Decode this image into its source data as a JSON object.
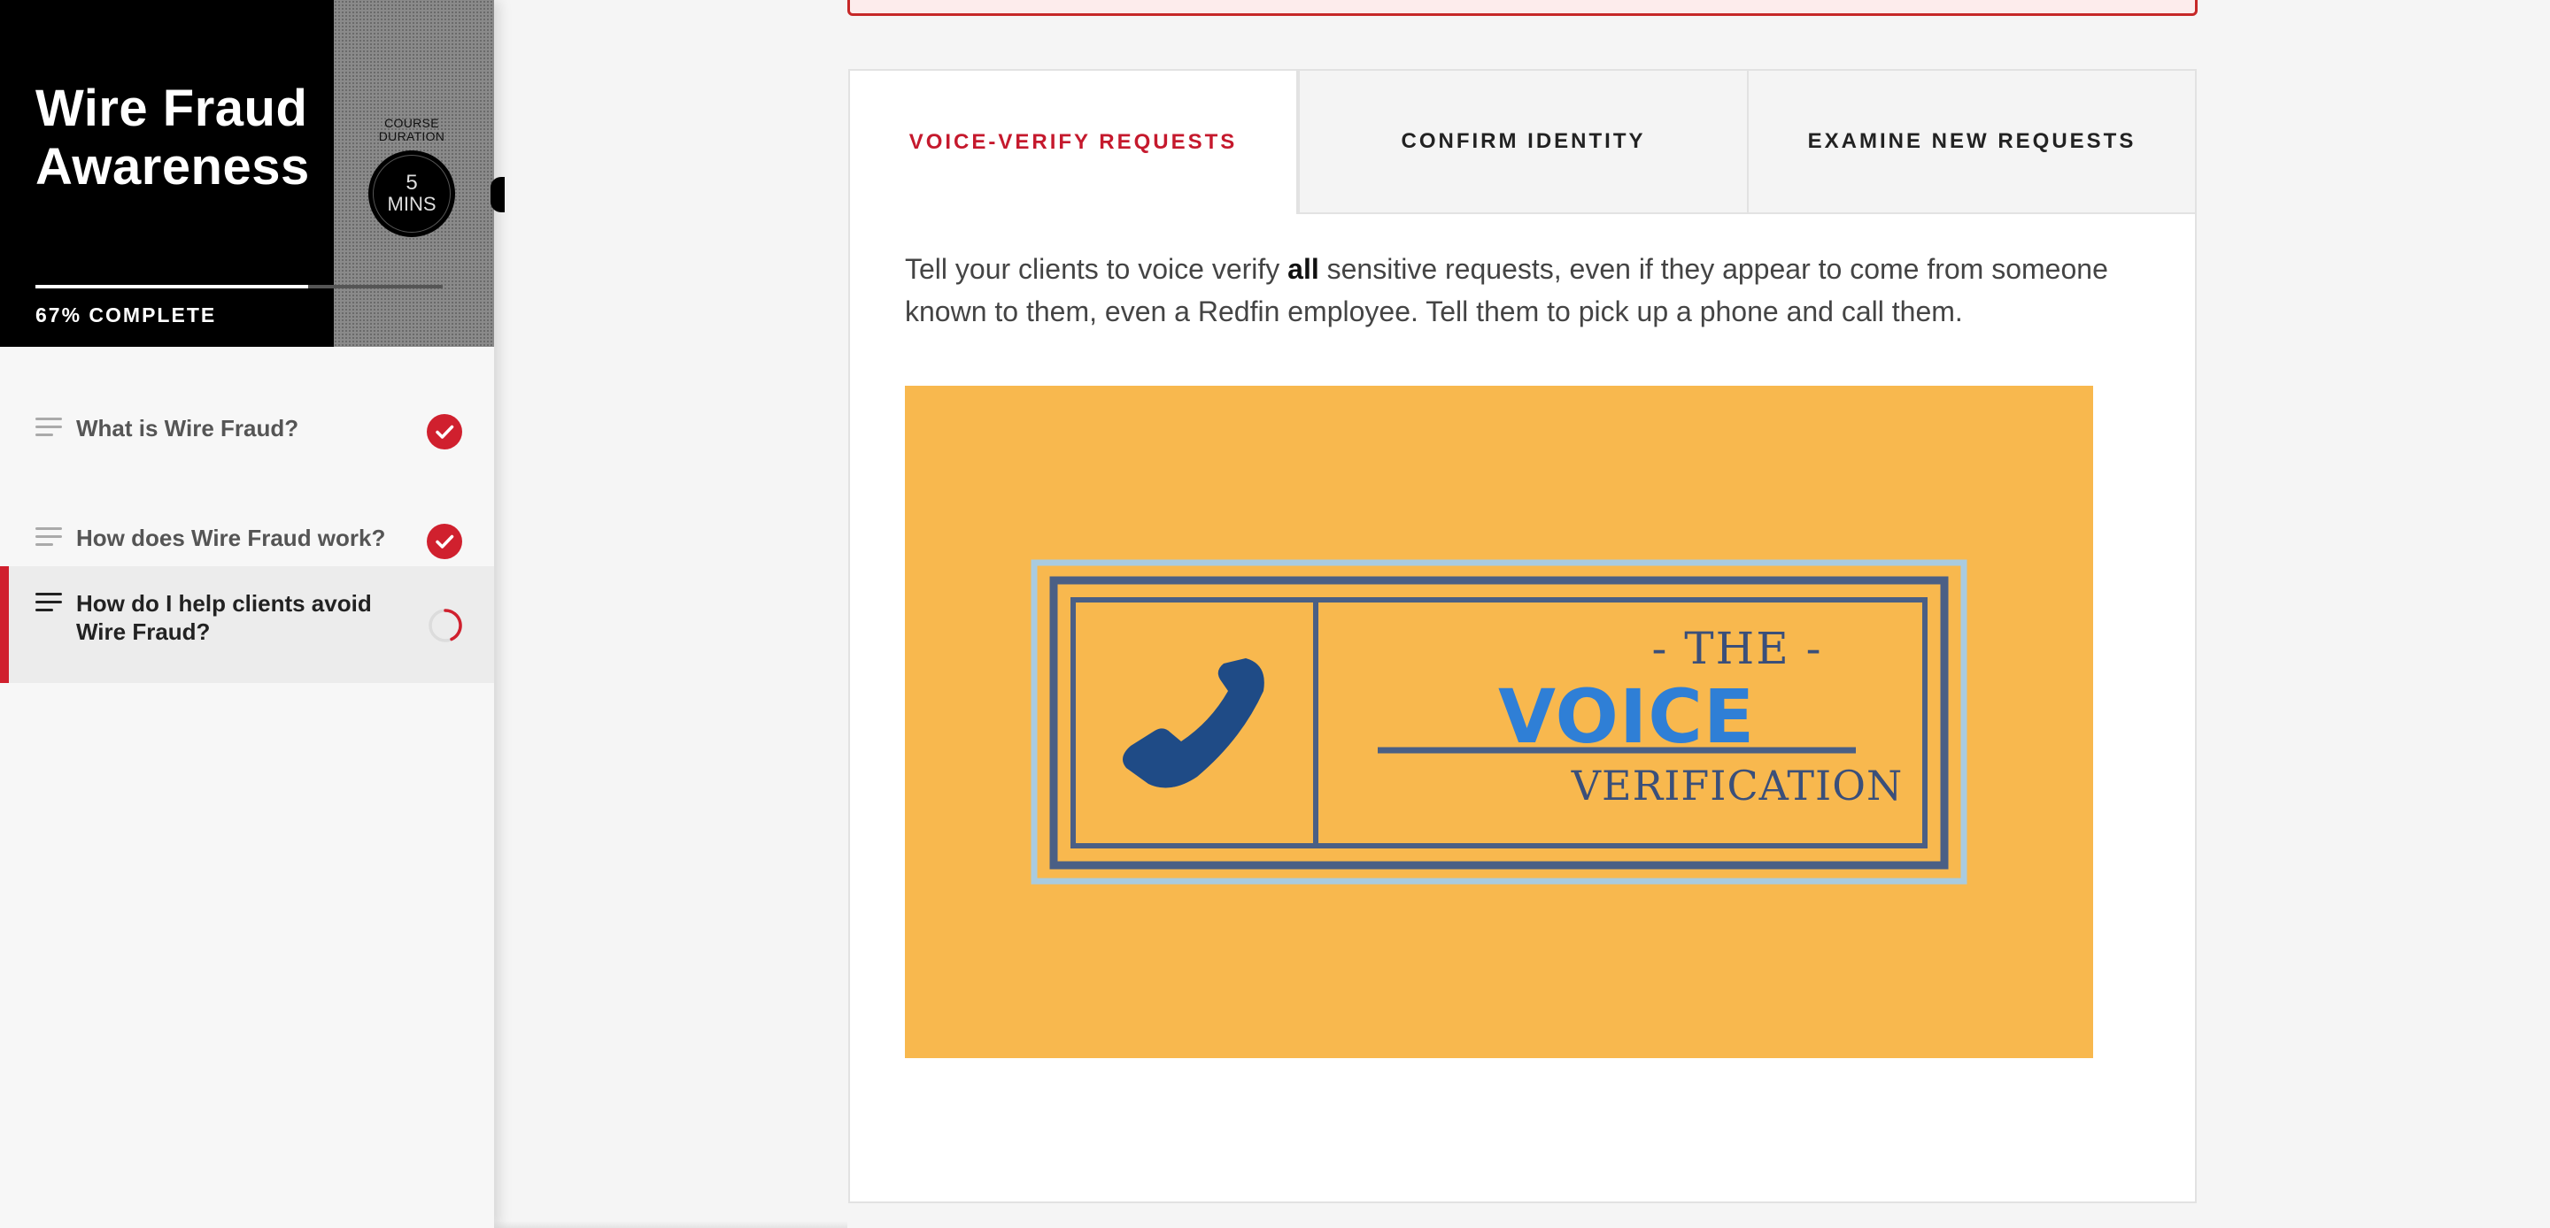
{
  "course": {
    "title": "Wire Fraud Awareness",
    "duration_label": "COURSE DURATION",
    "duration_value": "5",
    "duration_unit": "MINS",
    "progress_percent": 67,
    "progress_text": "67% COMPLETE"
  },
  "lessons": [
    {
      "label": "What is Wire Fraud?",
      "status": "complete",
      "icon": "list-icon",
      "status_icon": "checkmark-icon"
    },
    {
      "label": "How does Wire Fraud work?",
      "status": "complete",
      "icon": "list-icon",
      "status_icon": "checkmark-icon"
    },
    {
      "label": "How do I help clients avoid Wire Fraud?",
      "status": "in-progress",
      "icon": "list-icon",
      "status_icon": "progress-ring-icon"
    }
  ],
  "tabs": [
    {
      "label": "VOICE-VERIFY REQUESTS",
      "active": true
    },
    {
      "label": "CONFIRM IDENTITY",
      "active": false
    },
    {
      "label": "EXAMINE NEW REQUESTS",
      "active": false
    }
  ],
  "content": {
    "text_before": "Tell your clients to voice verify ",
    "text_bold": "all",
    "text_after": " sensitive requests, even if they appear to come from someone known to them, even a Redfin employee. Tell them to pick up a phone and call them.",
    "image": {
      "line1": "- THE -",
      "line2": "VOICE",
      "line3": "VERIFICATION",
      "icon": "phone-icon"
    }
  },
  "colors": {
    "accent_red": "#d0202e",
    "tab_active_text": "#c5192d",
    "hero_bg": "#f8b84e",
    "hero_navy": "#3a4f7a",
    "hero_blue": "#2f7fd6",
    "phone_blue": "#1f4b86"
  }
}
